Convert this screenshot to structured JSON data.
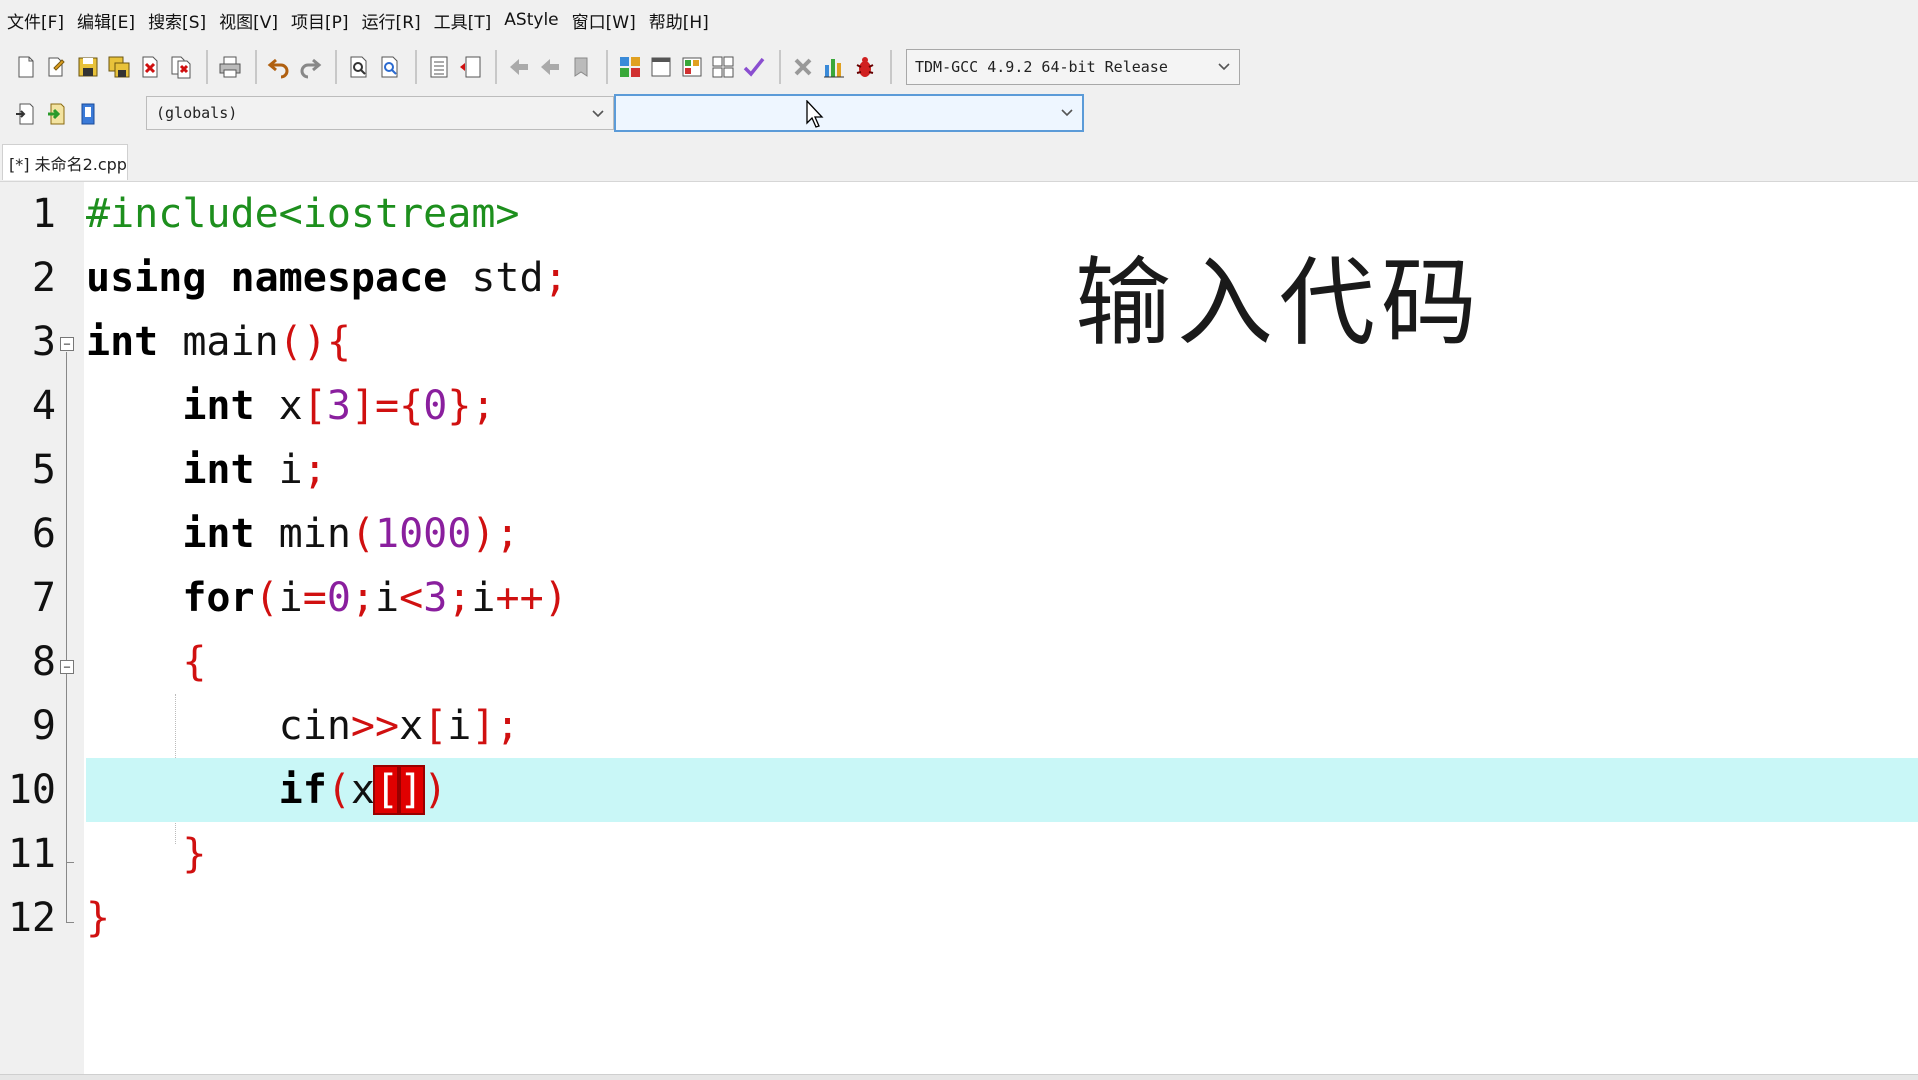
{
  "menu": [
    "文件[F]",
    "编辑[E]",
    "搜索[S]",
    "视图[V]",
    "项目[P]",
    "运行[R]",
    "工具[T]",
    "AStyle",
    "窗口[W]",
    "帮助[H]"
  ],
  "toolbar": {
    "compiler": "TDM-GCC 4.9.2 64-bit Release"
  },
  "toolbar2": {
    "scope": "(globals)",
    "function": ""
  },
  "tab": {
    "label": "[*] 未命名2.cpp"
  },
  "editor": {
    "line_numbers": [
      "1",
      "2",
      "3",
      "4",
      "5",
      "6",
      "7",
      "8",
      "9",
      "10",
      "11",
      "12"
    ],
    "current_line": 10,
    "lines": [
      "#include<iostream>",
      "using namespace std;",
      "int main(){",
      "    int x[3]={0};",
      "    int i;",
      "    int min(1000);",
      "    for(i=0;i<3;i++)",
      "    {",
      "        cin>>x[i];",
      "        if(x[])",
      "    }",
      "}"
    ]
  },
  "overlay": {
    "caption": "输入代码"
  },
  "colors": {
    "keyword": "#000000",
    "preprocessor": "#1d8f1d",
    "symbol": "#d01010",
    "number": "#8a1f9e",
    "current_line": "#c9f7f7"
  }
}
